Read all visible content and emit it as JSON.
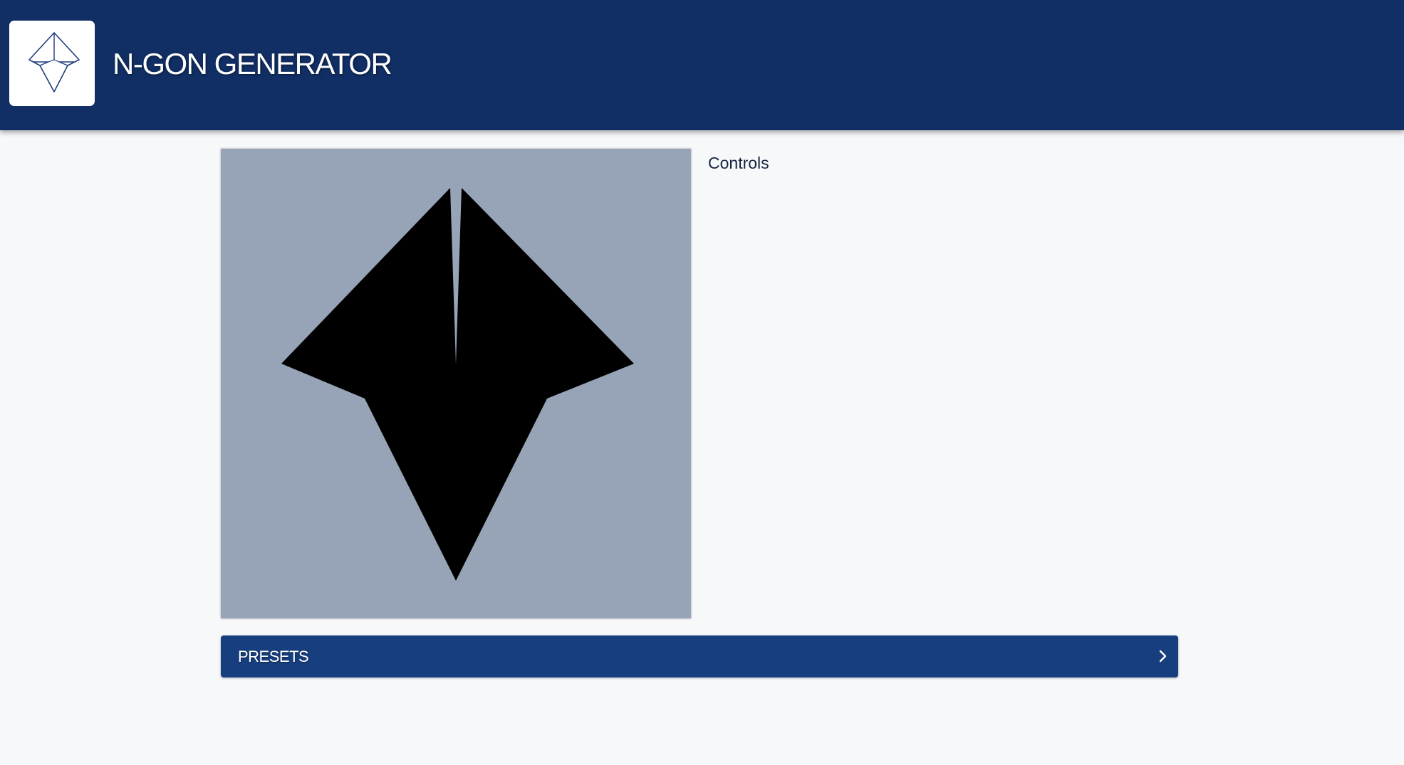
{
  "header": {
    "title": "N-GON GENERATOR",
    "logo_icon": "n-gon-logo-icon",
    "background": "#112f65"
  },
  "canvas": {
    "background": "#97a4b7",
    "shape_fill": "#000000",
    "shape_icon": "n-gon-shape"
  },
  "controls": {
    "label": "Controls"
  },
  "presets": {
    "label": "PRESETS",
    "icon": "chevron-right-icon",
    "background": "#173f7f"
  }
}
